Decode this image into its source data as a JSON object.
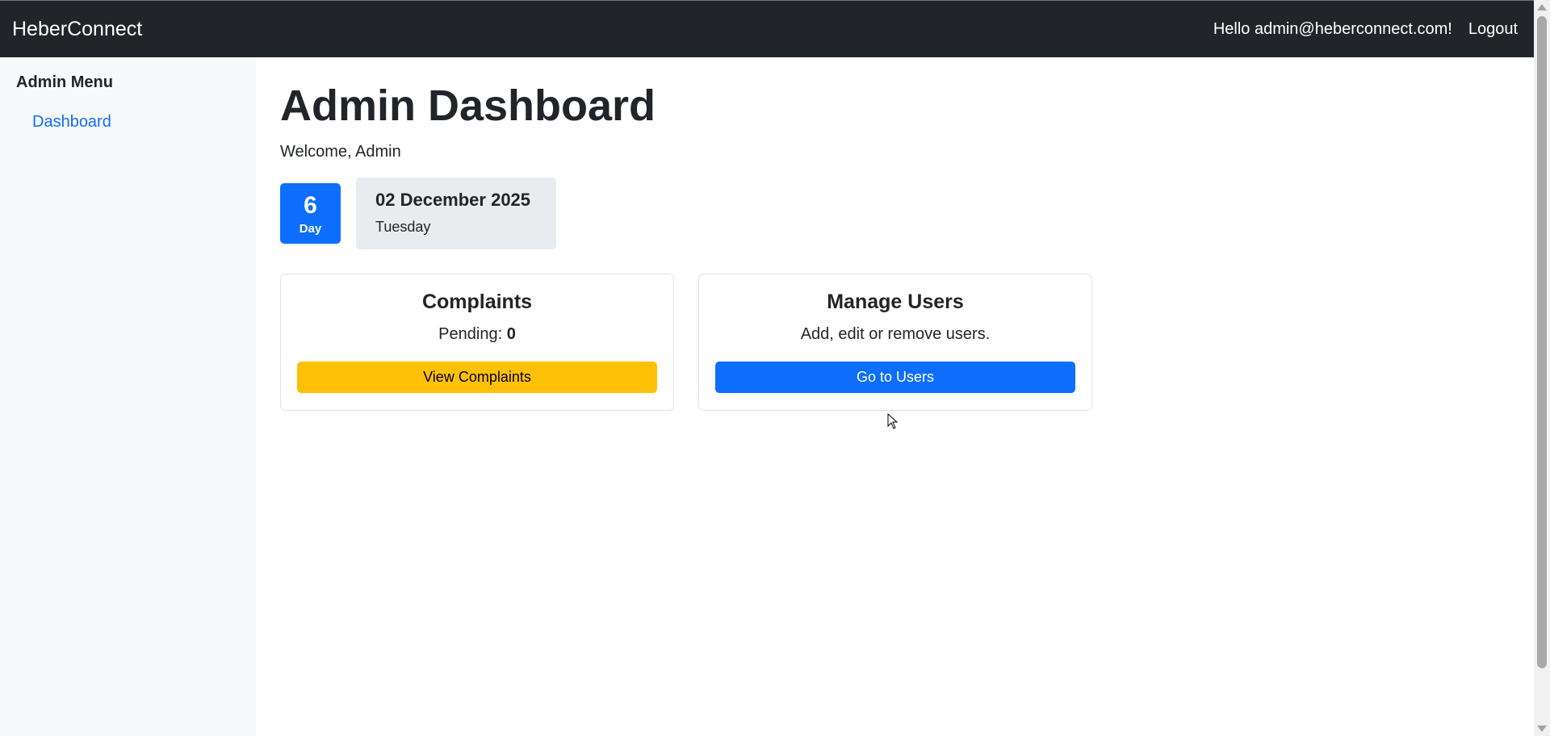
{
  "navbar": {
    "brand": "HeberConnect",
    "greeting": "Hello admin@heberconnect.com!",
    "logout_label": "Logout"
  },
  "sidebar": {
    "heading": "Admin Menu",
    "items": [
      {
        "label": "Dashboard"
      }
    ]
  },
  "main": {
    "title": "Admin Dashboard",
    "welcome": "Welcome, Admin",
    "date_widget": {
      "day_number": "6",
      "day_label": "Day",
      "date": "02 December 2025",
      "weekday": "Tuesday"
    },
    "cards": [
      {
        "title": "Complaints",
        "text_label": "Pending:",
        "text_value": "0",
        "button_label": "View Complaints"
      },
      {
        "title": "Manage Users",
        "text": "Add, edit or remove users.",
        "button_label": "Go to Users"
      }
    ]
  },
  "colors": {
    "navbar_bg": "#212529",
    "sidebar_bg": "#f8f9fa",
    "primary": "#0d6efd",
    "warning": "#ffc107",
    "date_box_bg": "#e9ecef"
  },
  "icons": {
    "cursor": "mouse-pointer-icon",
    "scroll_up": "scroll-up-arrow-icon",
    "scroll_down": "scroll-down-arrow-icon"
  }
}
